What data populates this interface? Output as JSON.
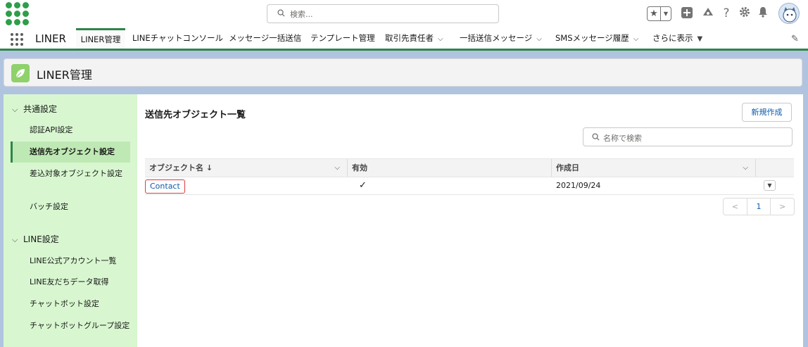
{
  "header": {
    "search_placeholder": "検索..."
  },
  "nav": {
    "app_name": "LINER",
    "tabs": [
      {
        "label": "LINER管理"
      },
      {
        "label": "LINEチャットコンソール"
      },
      {
        "label": "メッセージ一括送信"
      },
      {
        "label": "テンプレート管理"
      },
      {
        "label": "取引先責任者"
      },
      {
        "label": "一括送信メッセージ"
      },
      {
        "label": "SMSメッセージ履歴"
      },
      {
        "label": "さらに表示"
      }
    ]
  },
  "page_header": {
    "title": "LINER管理"
  },
  "sidebar": {
    "section1": "共通設定",
    "items1": [
      "認証API設定",
      "送信先オブジェクト設定",
      "差込対象オブジェクト設定",
      "バッチ設定"
    ],
    "section2": "LINE設定",
    "items2": [
      "LINE公式アカウント一覧",
      "LINE友だちデータ取得",
      "チャットボット設定",
      "チャットボットグループ設定"
    ]
  },
  "main": {
    "title": "送信先オブジェクト一覧",
    "new_button": "新規作成",
    "search_placeholder": "名称で検索",
    "columns": [
      "オブジェクト名 ↓",
      "有効",
      "作成日"
    ],
    "rows": [
      {
        "name": "Contact",
        "active": "✓",
        "created": "2021/09/24"
      }
    ],
    "pager": {
      "prev": "<",
      "page": "1",
      "next": ">"
    }
  },
  "colors": {
    "brand_green": "#2e844a",
    "sidebar_bg": "#d8f7d0",
    "link_blue": "#0b5cab",
    "highlight_red": "#e0393e"
  }
}
